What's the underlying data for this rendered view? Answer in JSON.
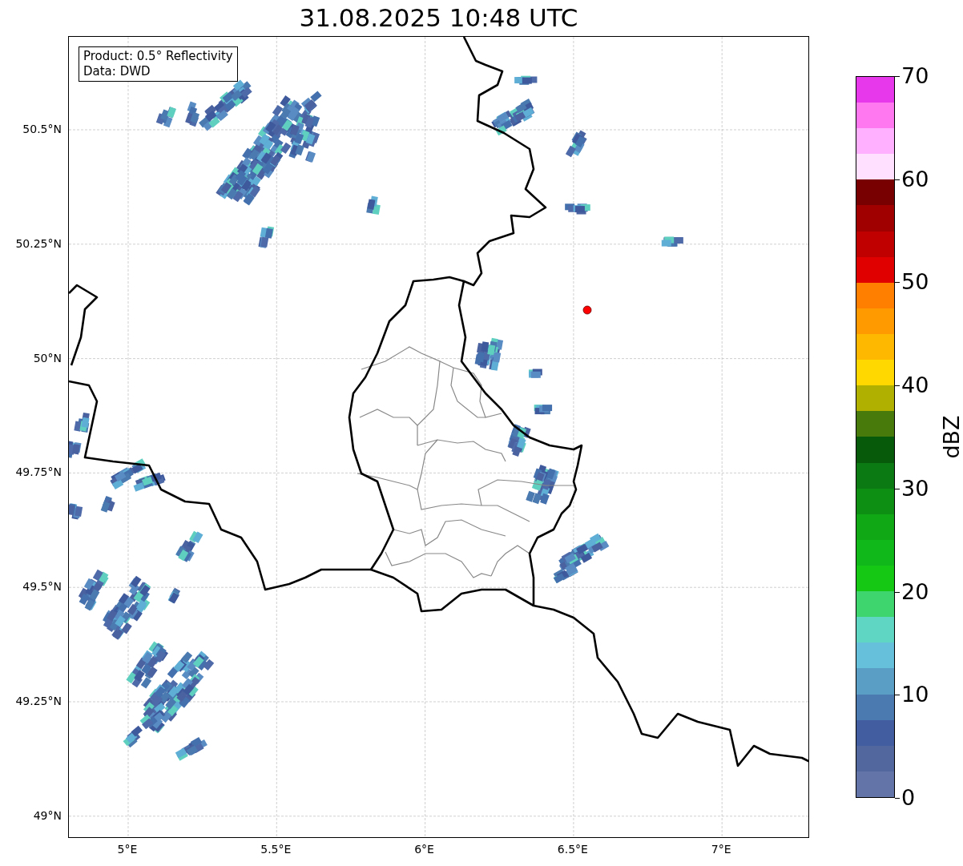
{
  "title": "31.08.2025 10:48 UTC",
  "info_box": [
    "Product: 0.5° Reflectivity",
    "Data: DWD"
  ],
  "lat_ticks": [
    "50.5°N",
    "50.25°N",
    "50°N",
    "49.75°N",
    "49.5°N",
    "49.25°N",
    "49°N"
  ],
  "lon_ticks": [
    "5°E",
    "5.5°E",
    "6°E",
    "6.5°E",
    "7°E"
  ],
  "colorbar": {
    "label": "dBZ",
    "ticks": [
      "70",
      "60",
      "50",
      "40",
      "30",
      "20",
      "10",
      "0"
    ],
    "bands": [
      {
        "color": "#6374a8"
      },
      {
        "color": "#53679f"
      },
      {
        "color": "#435ea0"
      },
      {
        "color": "#4a7ab0"
      },
      {
        "color": "#5a9ec5"
      },
      {
        "color": "#66c0dc"
      },
      {
        "color": "#5fd6c3"
      },
      {
        "color": "#3ed46e"
      },
      {
        "color": "#14c814"
      },
      {
        "color": "#10b81a"
      },
      {
        "color": "#10a814"
      },
      {
        "color": "#0d8f14"
      },
      {
        "color": "#0b7a12"
      },
      {
        "color": "#075a0a"
      },
      {
        "color": "#487a0b"
      },
      {
        "color": "#b0b000"
      },
      {
        "color": "#ffd800"
      },
      {
        "color": "#ffb800"
      },
      {
        "color": "#ff9a00"
      },
      {
        "color": "#ff7f00"
      },
      {
        "color": "#e00000"
      },
      {
        "color": "#c00000"
      },
      {
        "color": "#a00000"
      },
      {
        "color": "#780000"
      },
      {
        "color": "#ffe0ff"
      },
      {
        "color": "#ffb0ff"
      },
      {
        "color": "#ff78f0"
      },
      {
        "color": "#e838ec"
      }
    ]
  }
}
